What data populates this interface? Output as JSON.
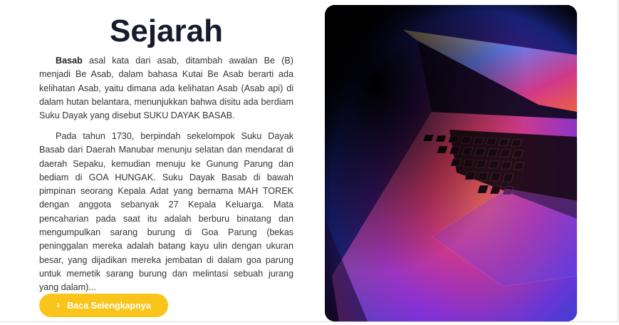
{
  "section": {
    "title": "Sejarah",
    "paragraph1": {
      "lead": "Basab",
      "text": " asal kata dari asab, ditambah awalan Be (B) menjadi Be Asab, dalam bahasa Kutai Be Asab berarti ada kelihatan Asab, yaitu dimana ada kelihatan Asab (Asab api) di dalam hutan belantara, menunjukkan bahwa disitu ada berdiam Suku Dayak yang disebut SUKU DAYAK BASAB."
    },
    "paragraph2": "Pada tahun 1730, berpindah sekelompok Suku Dayak Basab dari Daerah Manubar menunju selatan dan mendarat di daerah Sepaku, kemudian menuju ke Gunung Parung dan bediam di GOA HUNGAK. Suku Dayak Basab di bawah pimpinan seorang Kepala Adat yang bernama MAH TOREK dengan anggota sebanyak 27 Kepala Keluarga. Mata pencaharian pada saat itu adalah berburu binatang dan mengumpulkan sarang burung di Goa Parung (bekas peninggalan mereka adalah batang kayu ulin dengan ukuran besar, yang dijadikan mereka jembatan di dalam goa parung untuk memetik sarang burung dan melintasi sebuah jurang yang dalam)...",
    "button": {
      "label": "Baca Selengkapnya",
      "icon": "chevron-right-icon"
    },
    "image": {
      "subject": "laptop-keyboard-photo"
    }
  },
  "colors": {
    "title": "#161c2d",
    "text": "#333333",
    "button_bg": "#f9c51a",
    "button_text": "#ffffff"
  }
}
